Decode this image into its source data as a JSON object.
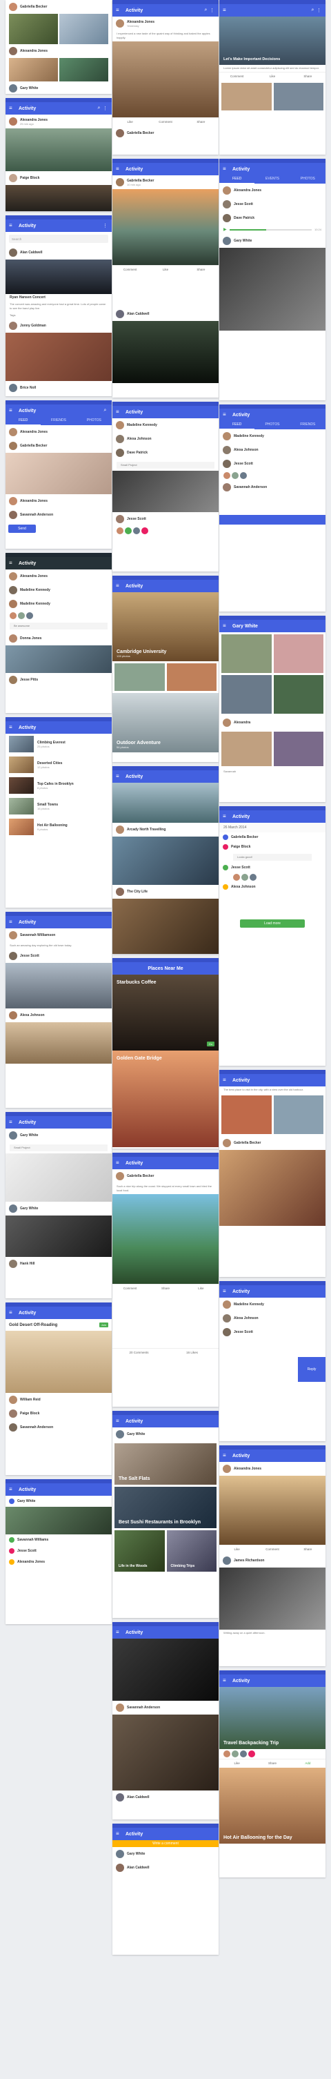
{
  "common": {
    "activity": "Activity",
    "menu_icon": "hamburger-menu-icon",
    "search_icon": "search-icon",
    "more_icon": "more-vert-icon",
    "comment": "Comment",
    "like": "Like",
    "share": "Share"
  },
  "colors": {
    "appbar": "#4360e0",
    "statusbar": "#3750c9",
    "accent_green": "#4caf50",
    "accent_orange": "#ffb300"
  },
  "col1": {
    "s1": {
      "user1": "Gabriella Becker",
      "user2": "Alexandra Jones",
      "user3": "Gary White"
    },
    "s2": {
      "user1": "Alexandra Jones",
      "time": "25 min ago",
      "caption": "Paige Block"
    },
    "s3": {
      "search_placeholder": "Search",
      "user": "Alan Caldwell",
      "title": "Ryan Hansen Concert",
      "body": "The concert was amazing and everyone had a great time. Lots of people came to see the band play live.",
      "tags_label": "Tags",
      "user2": "Jonny Goldman",
      "caption": "Brice Noll"
    },
    "s4": {
      "tabs": [
        "FEED",
        "FRIENDS",
        "PHOTOS"
      ],
      "user1": "Alexandra Jones",
      "user2": "Gabriella Becker",
      "user3": "Alexandra Jones",
      "user4": "Savannah Anderson",
      "btn": "Send"
    },
    "s5": {
      "user1": "Alexandra Jones",
      "user2": "Madeline Kennedy",
      "user3": "Madeline Kennedy",
      "user4": "Donna Jones",
      "user5": "Jesse Pitts",
      "label": "Be awesome"
    },
    "s6": {
      "items": [
        {
          "title": "Climbing Everest",
          "sub": "25 photos"
        },
        {
          "title": "Deserted Cities",
          "sub": "12 photos"
        },
        {
          "title": "Top Cafes in Brooklyn",
          "sub": "8 photos"
        },
        {
          "title": "Small Towns",
          "sub": "16 photos"
        },
        {
          "title": "Hot Air Ballooning",
          "sub": "9 photos"
        }
      ]
    },
    "s7": {
      "user1": "Savannah Williamson",
      "user2": "Jesse Scott",
      "user3": "Alexa Johnson",
      "body": "Such an amazing day exploring the old town today."
    },
    "s8": {
      "user1": "Gary White",
      "user2": "Gary White",
      "user3": "Hank Hill",
      "label": "Small Project"
    },
    "s9": {
      "title": "Gold Desert Off-Roading",
      "btn": "Join",
      "user1": "William Reid",
      "user2": "Paige Block",
      "user3": "Savannah Anderson"
    },
    "s10": {
      "user1": "Gary White",
      "user2": "Savannah Williams",
      "user3": "Jesse Scott",
      "user4": "Alexandra Jones"
    }
  },
  "col2": {
    "s1": {
      "user1": "Alexandra Jones",
      "time": "Yesterday",
      "body": "I experienced a new taste of the quaint way of thinking and baked the apples happily.",
      "user2": "Gabriella Becker"
    },
    "s2": {
      "user1": "Gabriella Becker",
      "time": "10 min ago",
      "user2": "Alan Caldwell"
    },
    "s3": {
      "user1": "Madeline Kennedy",
      "user2": "Alexa Johnson",
      "user3": "Dave Patrick",
      "user4": "Jesse Scott",
      "label": "Small Project"
    },
    "s4": {
      "title": "Cambridge University",
      "sub": "128 photos",
      "title2": "Outdoor Adventure",
      "sub2": "54 photos"
    },
    "s5": {
      "title": "Arcady North Travelling",
      "title2": "The City Life"
    },
    "s6": {
      "header": "Places Near Me",
      "title": "Starbucks Coffee",
      "title2": "Golden Gate Bridge",
      "btn": "Go"
    },
    "s7": {
      "user1": "Gabriella Becker",
      "body": "Such a nice trip along the coast. We stopped at every small town and tried the local food.",
      "comment_label": "20 Comments",
      "like_label": "16 Likes"
    },
    "s8": {
      "user1": "Gary White",
      "cards": [
        "The Salt Flats",
        "Best Sushi Restaurants in Brooklyn",
        "Life in the Woods",
        "Climbing Trips"
      ]
    },
    "s9": {
      "user1": "Savannah Anderson",
      "user2": "Alan Caldwell"
    },
    "s10": {
      "banner": "Write a comment",
      "user1": "Gary White",
      "user2": "Alan Caldwell"
    }
  },
  "col3": {
    "s1": {
      "title": "Let's Make Important Decisions",
      "body": "Lorem ipsum dolor sit amet consectetur adipiscing elit sed do eiusmod tempor."
    },
    "s2": {
      "tabs": [
        "FEED",
        "EVENTS",
        "PHOTOS"
      ],
      "user1": "Alexandra Jones",
      "user2": "Jesse Scott",
      "user3": "Dave Patrick",
      "user4": "Gary White",
      "time": "10:24"
    },
    "s3": {
      "tabs": [
        "FEED",
        "PHOTOS",
        "FRIENDS"
      ],
      "user1": "Madeline Kennedy",
      "user2": "Alexa Johnson",
      "user3": "Jesse Scott",
      "user4": "Savannah Anderson"
    },
    "s4": {
      "user1": "Gary White",
      "user2": "Alexandra",
      "label": "Savannah"
    },
    "s5": {
      "date": "26 March 2014",
      "user1": "Gabriella Becker",
      "user2": "Paige Block",
      "user3": "Jesse Scott",
      "user4": "Alexa Johnson",
      "label": "Looks good!",
      "btn": "Load more"
    },
    "s6": {
      "user1": "Gabriella Becker",
      "body": "The best place to visit in the city, with a view over the old harbour."
    },
    "s7": {
      "user1": "Madeline Kennedy",
      "user2": "Alexa Johnson",
      "user3": "Jesse Scott",
      "fab": "Reply"
    },
    "s8": {
      "user1": "Alexandra Jones",
      "user2": "James Richardson",
      "body": "Writing away on a quiet afternoon."
    },
    "s9": {
      "title": "Travel Backpacking Trip",
      "tabs": [
        "Like",
        "Share",
        "Add"
      ],
      "title2": "Hot Air Ballooning for the Day"
    }
  }
}
